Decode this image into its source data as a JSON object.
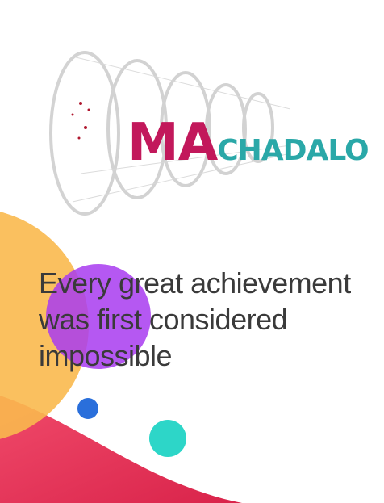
{
  "logo": {
    "text_big": "MA",
    "text_small": "CHADALO",
    "colors": {
      "primary": "#c2185b",
      "secondary": "#7b3fa0",
      "accent": "#2aa8a8",
      "warm": "#e07b39"
    }
  },
  "quote": {
    "text": "Every great achievement was first considered impossible"
  },
  "colors": {
    "orange": "#f9b94e",
    "purple": "#a83bf0",
    "blue": "#2a6fdb",
    "teal": "#2dd6c8",
    "wave_start": "#f04a6a",
    "wave_end": "#d9234a"
  }
}
